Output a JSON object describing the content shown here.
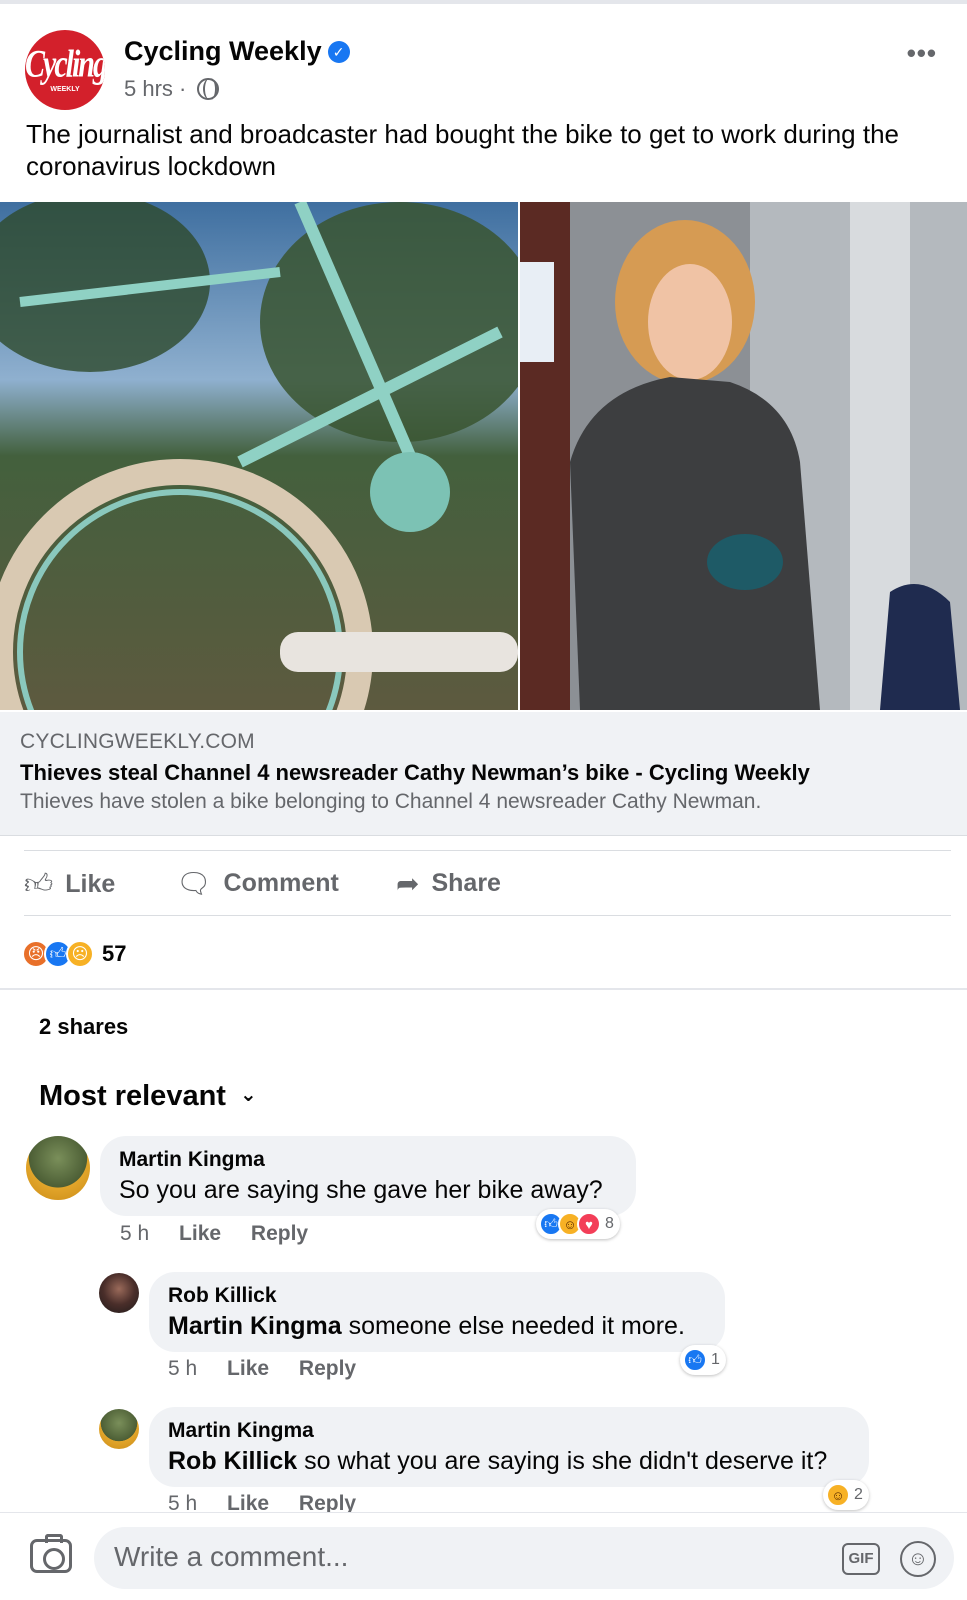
{
  "post": {
    "page_name": "Cycling Weekly",
    "logo_text": "Cycling",
    "logo_subtext": "WEEKLY",
    "verified_icon": "verified-badge-icon",
    "time": "5 hrs",
    "separator": "·",
    "privacy_icon": "globe-icon",
    "more_icon": "•••",
    "text": "The journalist and broadcaster had bought the bike to get to work during the coronavirus lockdown"
  },
  "link": {
    "domain": "CYCLINGWEEKLY.COM",
    "title": "Thieves steal Channel 4 newsreader Cathy Newman’s bike - Cycling Weekly",
    "description": "Thieves have stolen a bike belonging to Channel 4 newsreader Cathy Newman."
  },
  "actions": {
    "like": "Like",
    "comment": "Comment",
    "share": "Share"
  },
  "reactions": {
    "count": "57",
    "types": [
      "angry",
      "like",
      "sad"
    ]
  },
  "shares": "2 shares",
  "sort": {
    "label": "Most relevant",
    "chevron": "⌄"
  },
  "comments": [
    {
      "author": "Martin Kingma",
      "mention": "",
      "text": "So you are saying she gave her bike away?",
      "time": "5 h",
      "like": "Like",
      "reply": "Reply",
      "reaction_count": "8"
    },
    {
      "author": "Rob Killick",
      "mention": "Martin Kingma",
      "text": " someone else needed it more.",
      "time": "5 h",
      "like": "Like",
      "reply": "Reply",
      "reaction_count": "1"
    },
    {
      "author": "Martin Kingma",
      "mention": "Rob Killick",
      "text": " so what you are saying is she didn't deserve it?",
      "time": "5 h",
      "like": "Like",
      "reply": "Reply",
      "reaction_count": "2"
    }
  ],
  "composer": {
    "placeholder": "Write a comment...",
    "gif": "GIF"
  },
  "colors": {
    "brand_red": "#d3202b",
    "facebook_blue": "#1877f2",
    "secondary_text": "#65676b"
  }
}
